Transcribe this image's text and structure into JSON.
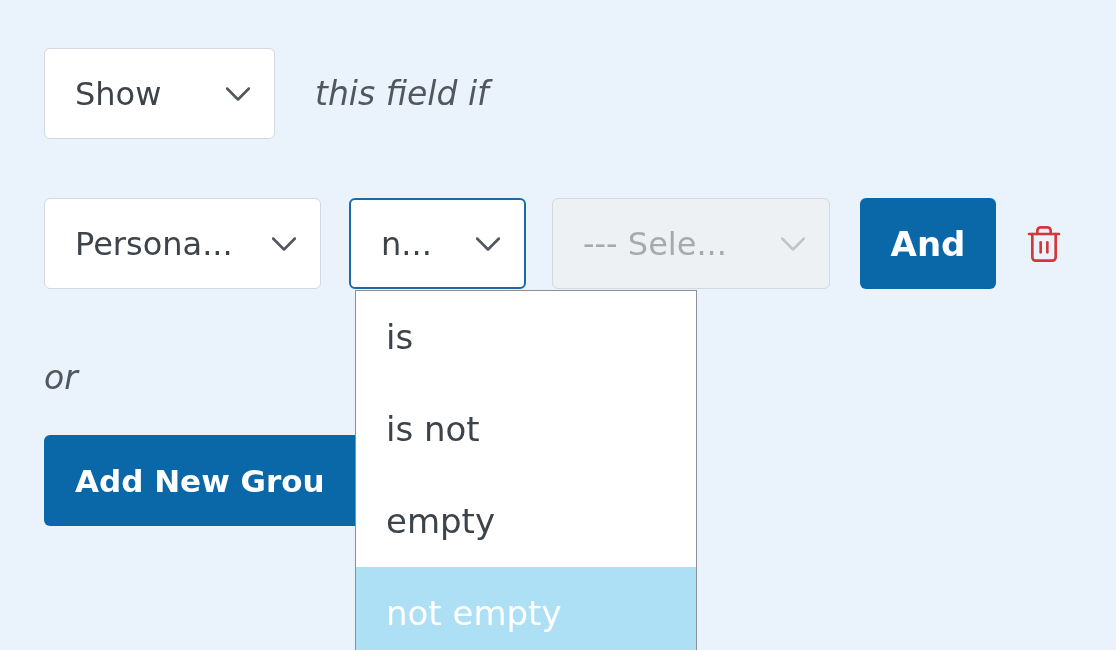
{
  "visibility_select": {
    "value": "Show"
  },
  "condition_text": "this field if",
  "rule": {
    "field_select": {
      "value": "Persona..."
    },
    "operator_select": {
      "value": "n...",
      "focused": true
    },
    "value_select": {
      "placeholder": "--- Sele...",
      "disabled": true
    },
    "and_button": "And"
  },
  "operator_options": [
    {
      "label": "is",
      "selected": false
    },
    {
      "label": "is not",
      "selected": false
    },
    {
      "label": "empty",
      "selected": false
    },
    {
      "label": "not empty",
      "selected": true
    }
  ],
  "or_label": "or",
  "add_group_button": "Add New Grou"
}
